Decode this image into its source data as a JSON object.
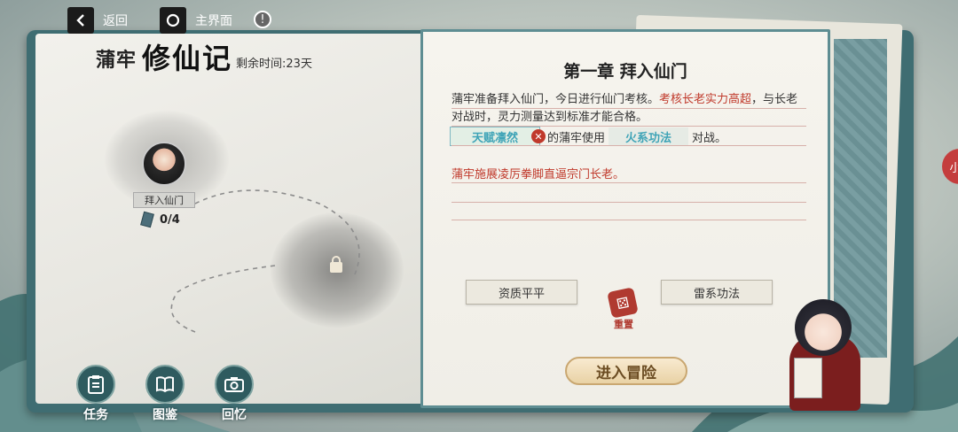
{
  "top_bar": {
    "back_label": "返回",
    "home_label": "主界面",
    "info_icon": "!"
  },
  "left_page": {
    "name": "蒲牢",
    "title": "修仙记",
    "remaining": "剩余时间:23天",
    "node": {
      "label": "拜入仙门",
      "count": "0/4"
    }
  },
  "bottom_nav": [
    {
      "label": "任务",
      "icon": "clipboard-icon"
    },
    {
      "label": "图鉴",
      "icon": "book-icon"
    },
    {
      "label": "回忆",
      "icon": "camera-icon"
    }
  ],
  "event": {
    "title": "第一章 拜入仙门",
    "para_plain": "蒲牢准备拜入仙门，今日进行仙门考核。",
    "para_red": "考核长老实力高超",
    "para_tail": "，与长老对战时，灵力测量达到标准才能合格。",
    "slot_a": "天赋凛然",
    "mid_text": "的蒲牢使用",
    "slot_b": "火系功法",
    "end_text": "对战。",
    "outcome": "蒲牢施展凌厉拳脚直逼宗门长老。"
  },
  "choices": {
    "left": "资质平平",
    "right": "雷系功法",
    "reset": "重置"
  },
  "enter_label": "进入冒险",
  "side_tab": "小",
  "colors": {
    "accent_red": "#c0392b",
    "accent_teal": "#3fa4b7",
    "book_teal": "#3f6d72"
  }
}
